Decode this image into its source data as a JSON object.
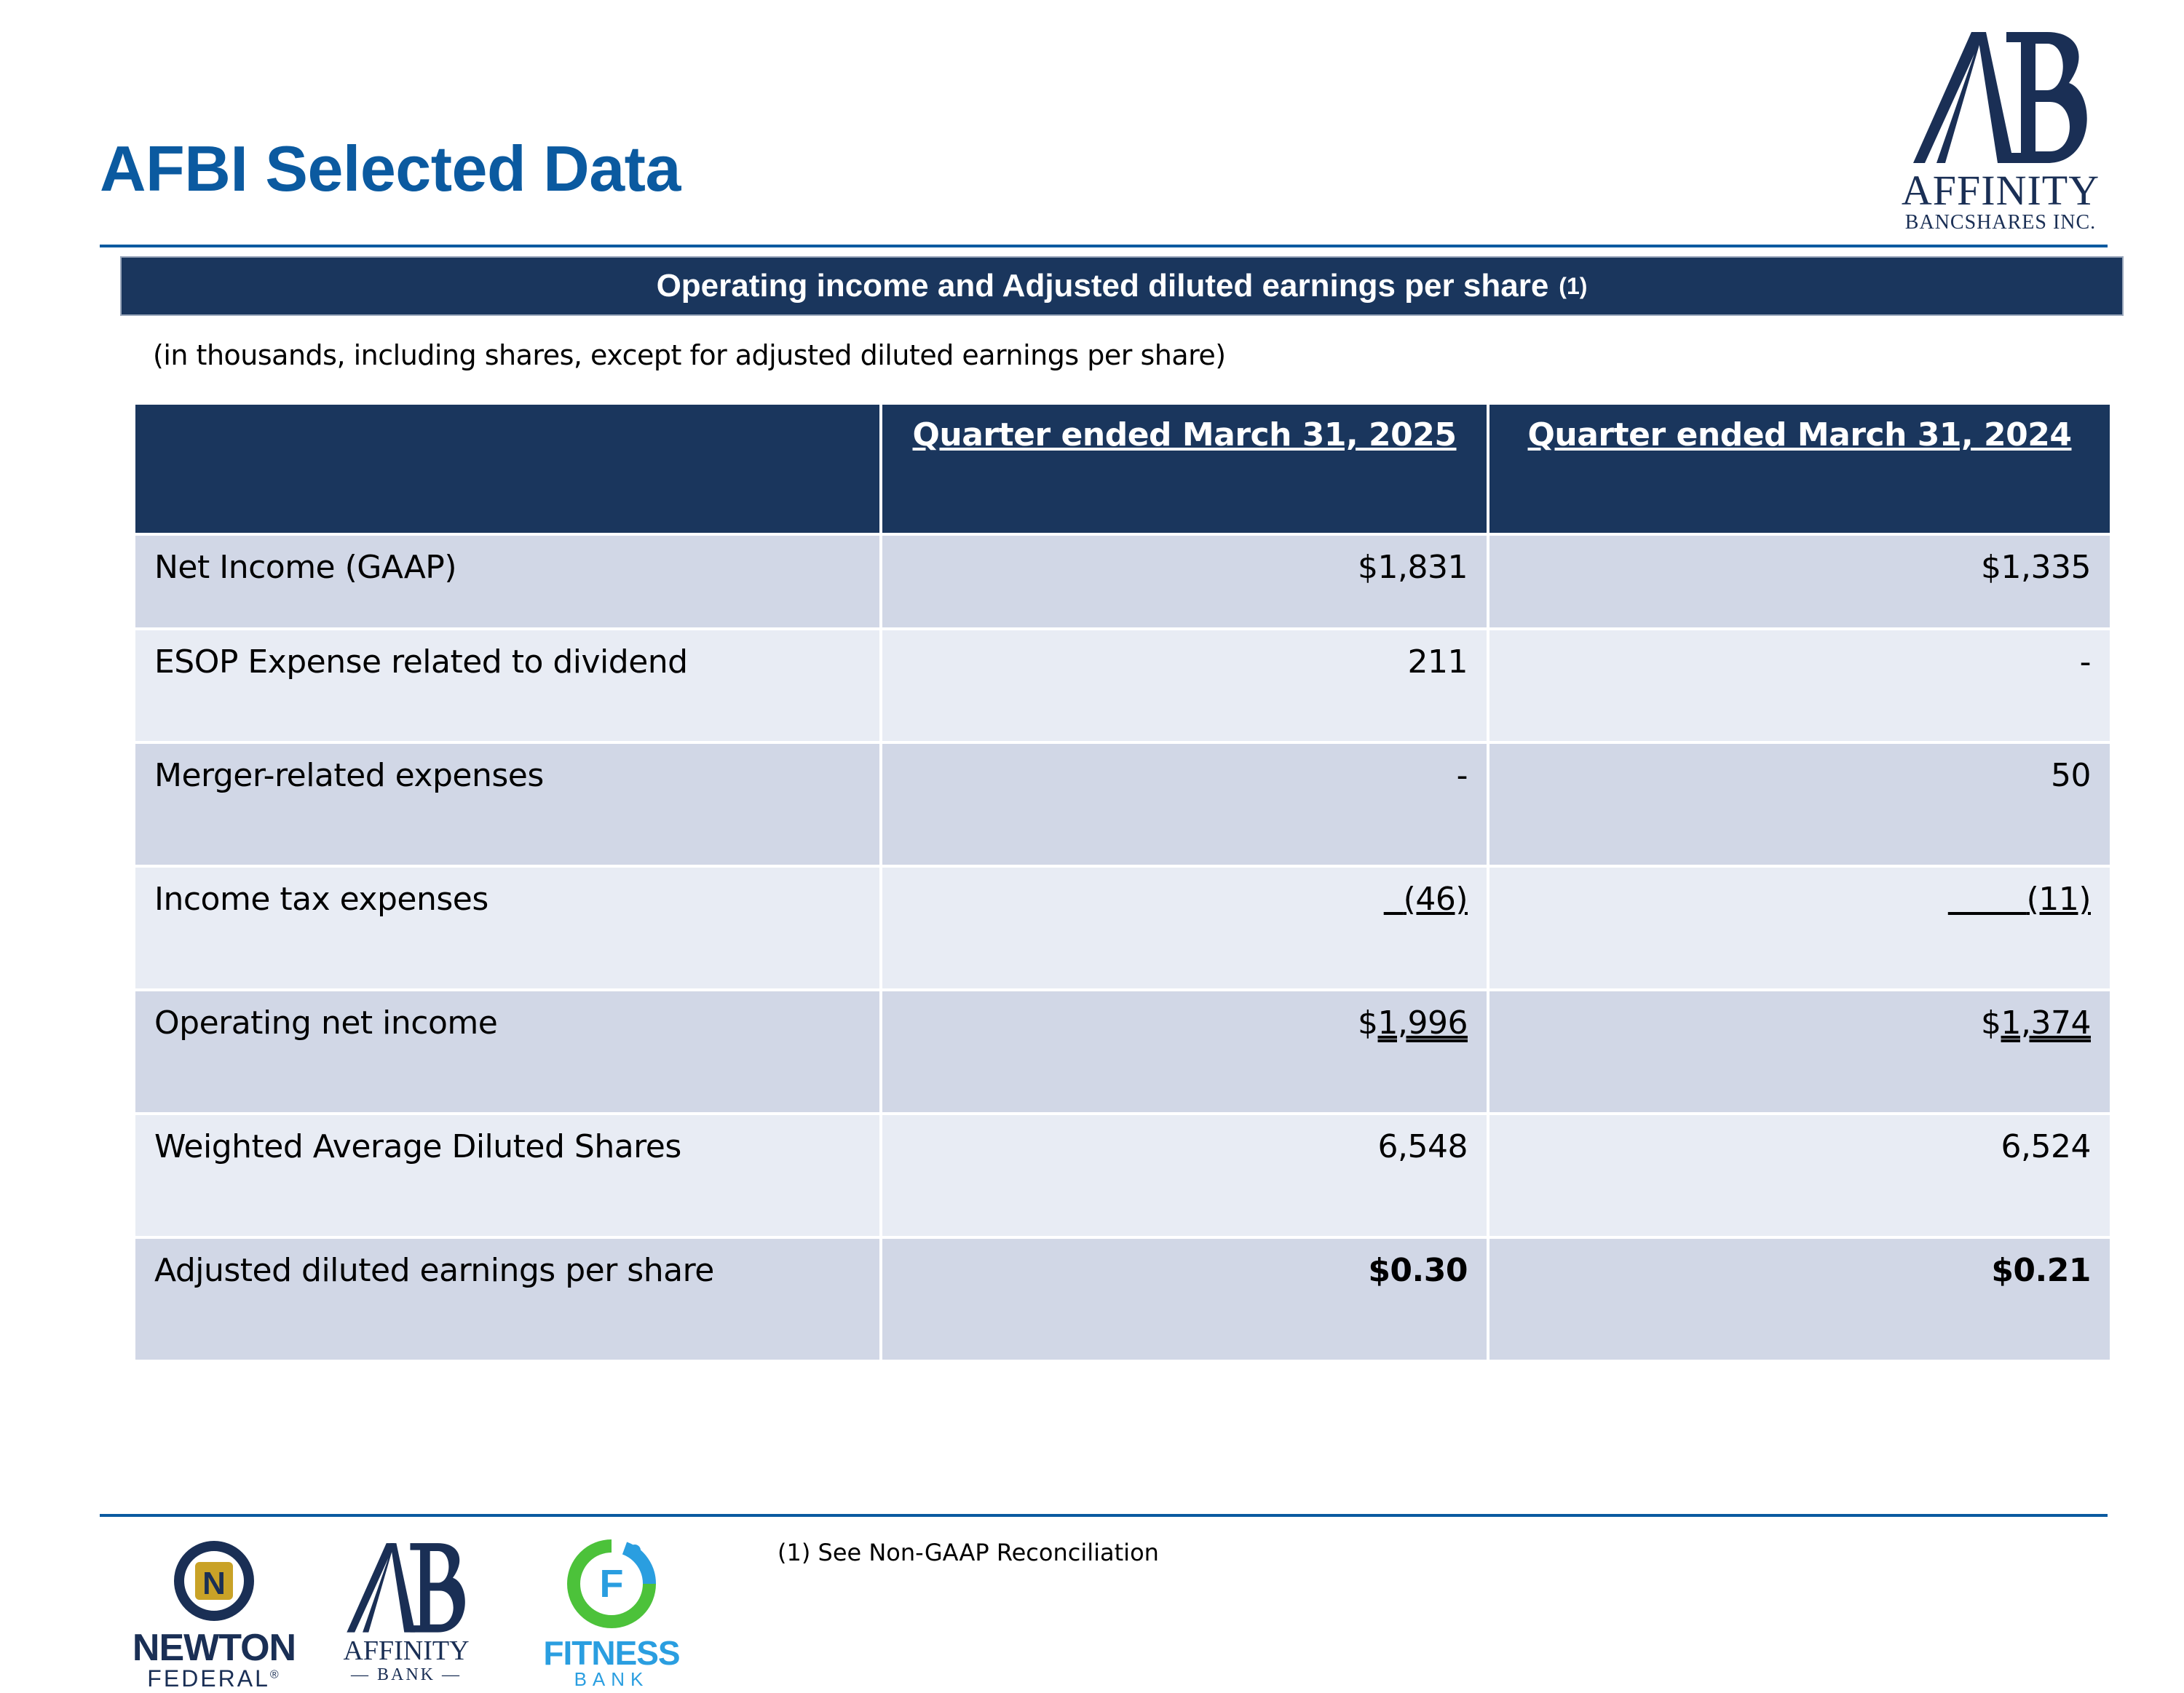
{
  "page": {
    "title": "AFBI Selected Data",
    "banner_title": "Operating income and Adjusted diluted earnings per share",
    "banner_footnote_ref": "(1)",
    "units_note": "(in thousands, including shares, except for adjusted diluted earnings per share)",
    "footnote": "(1) See Non-GAAP Reconciliation"
  },
  "corporate_logo": {
    "monogram": "AB",
    "name": "AFFINITY",
    "subtitle": "BANCSHARES INC."
  },
  "table": {
    "headers": [
      "",
      "Quarter ended March 31, 2025",
      "Quarter ended March 31, 2024"
    ],
    "rows": [
      {
        "label": "Net Income (GAAP)",
        "q2025": "$1,831",
        "q2024": "$1,335"
      },
      {
        "label": "ESOP Expense related to dividend",
        "q2025": "211",
        "q2024": "-"
      },
      {
        "label": "Merger-related expenses",
        "q2025": "-",
        "q2024": "50"
      },
      {
        "label": "Income tax expenses",
        "q2025": "(46)",
        "q2024": "(11)"
      },
      {
        "label": "Operating net income",
        "q2025_symbol": "$",
        "q2025": "1,996",
        "q2024_symbol": "$",
        "q2024": "1,374"
      },
      {
        "label": "Weighted Average Diluted Shares",
        "q2025": "6,548",
        "q2024": "6,524"
      },
      {
        "label": "Adjusted diluted earnings per share",
        "q2025": "$0.30",
        "q2024": "$0.21"
      }
    ]
  },
  "bottom_logos": {
    "newton": {
      "name": "NEWTON",
      "sub": "FEDERAL",
      "mark": "N",
      "registered": "®"
    },
    "affinity_bank": {
      "name": "AFFINITY",
      "sub": "— BANK —"
    },
    "fitness": {
      "name": "FITNESS",
      "sub": "BANK",
      "mark": "F"
    }
  },
  "colors": {
    "title_blue": "#0b5aa0",
    "navy": "#1a365d",
    "row_dark": "#d1d7e6",
    "row_light": "#e8ecf4",
    "fitness_blue": "#2a9ee0",
    "fitness_green": "#4cc23a",
    "newton_gold": "#c9a227"
  }
}
